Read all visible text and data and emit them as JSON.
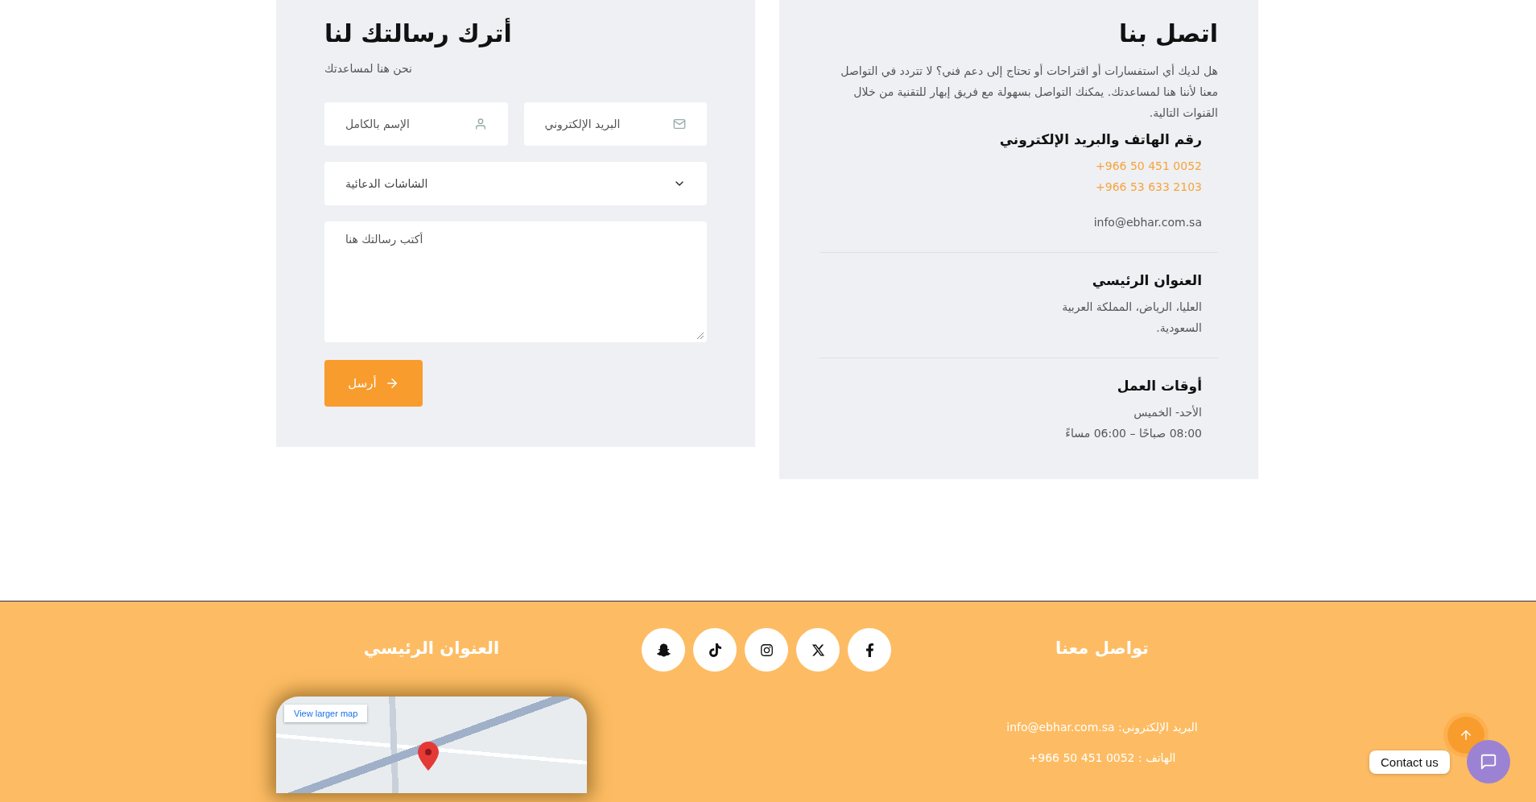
{
  "form": {
    "title": "أترك رسالتك لنا",
    "subtitle": "نحن هنا لمساعدتك",
    "fields": [
      {
        "kind": "email",
        "placeholder": "البريد الإلكتروني"
      },
      {
        "kind": "name",
        "placeholder": "الإسم بالكامل"
      }
    ],
    "service_select": {
      "value": "الشاشات الدعائية"
    },
    "message": {
      "placeholder": "أكتب رسالتك هنا"
    },
    "submit": {
      "label": "أرسل"
    }
  },
  "contact": {
    "title": "اتصل بنا",
    "intro": "هل لديك أي استفسارات أو اقتراحات أو تحتاج إلى دعم فني؟ لا تتردد في التواصل معنا لأننا هنا لمساعدتك. يمكنك التواصل بسهولة مع فريق إبهار للتقنية من خلال القنوات التالية.",
    "sections": [
      {
        "heading": "رقم الهاتف والبريد الإلكتروني",
        "lines": [
          {
            "kind": "phone",
            "text": "+966 50 451 0052"
          },
          {
            "kind": "phone",
            "text": "+966 53 633 2103"
          },
          {
            "kind": "email",
            "text": "info@ebhar.com.sa"
          }
        ]
      },
      {
        "heading": "العنوان الرئيسي",
        "lines": [
          {
            "kind": "text",
            "text": "العليا، الرياض، المملكة العربية السعودية."
          }
        ]
      },
      {
        "heading": "أوقات العمل",
        "lines": [
          {
            "kind": "text",
            "text": "الأحد- الخميس"
          },
          {
            "kind": "text",
            "text": "08:00 صباحًا – 06:00 مساءً"
          }
        ]
      }
    ]
  },
  "footer": {
    "address_heading": "العنوان الرئيسي",
    "map": {
      "link_label": "View larger map"
    },
    "social": [
      {
        "kind": "snapchat"
      },
      {
        "kind": "tiktok"
      },
      {
        "kind": "instagram"
      },
      {
        "kind": "x"
      },
      {
        "kind": "facebook"
      }
    ],
    "contact_heading": "تواصل معنا",
    "email_line": {
      "label": "البريد الإلكتروني:",
      "value": "info@ebhar.com.sa"
    },
    "phone_line": {
      "label": "الهاتف :",
      "value": "+966 50 451 0052"
    }
  },
  "widgets": {
    "contact_label": "Contact us"
  }
}
